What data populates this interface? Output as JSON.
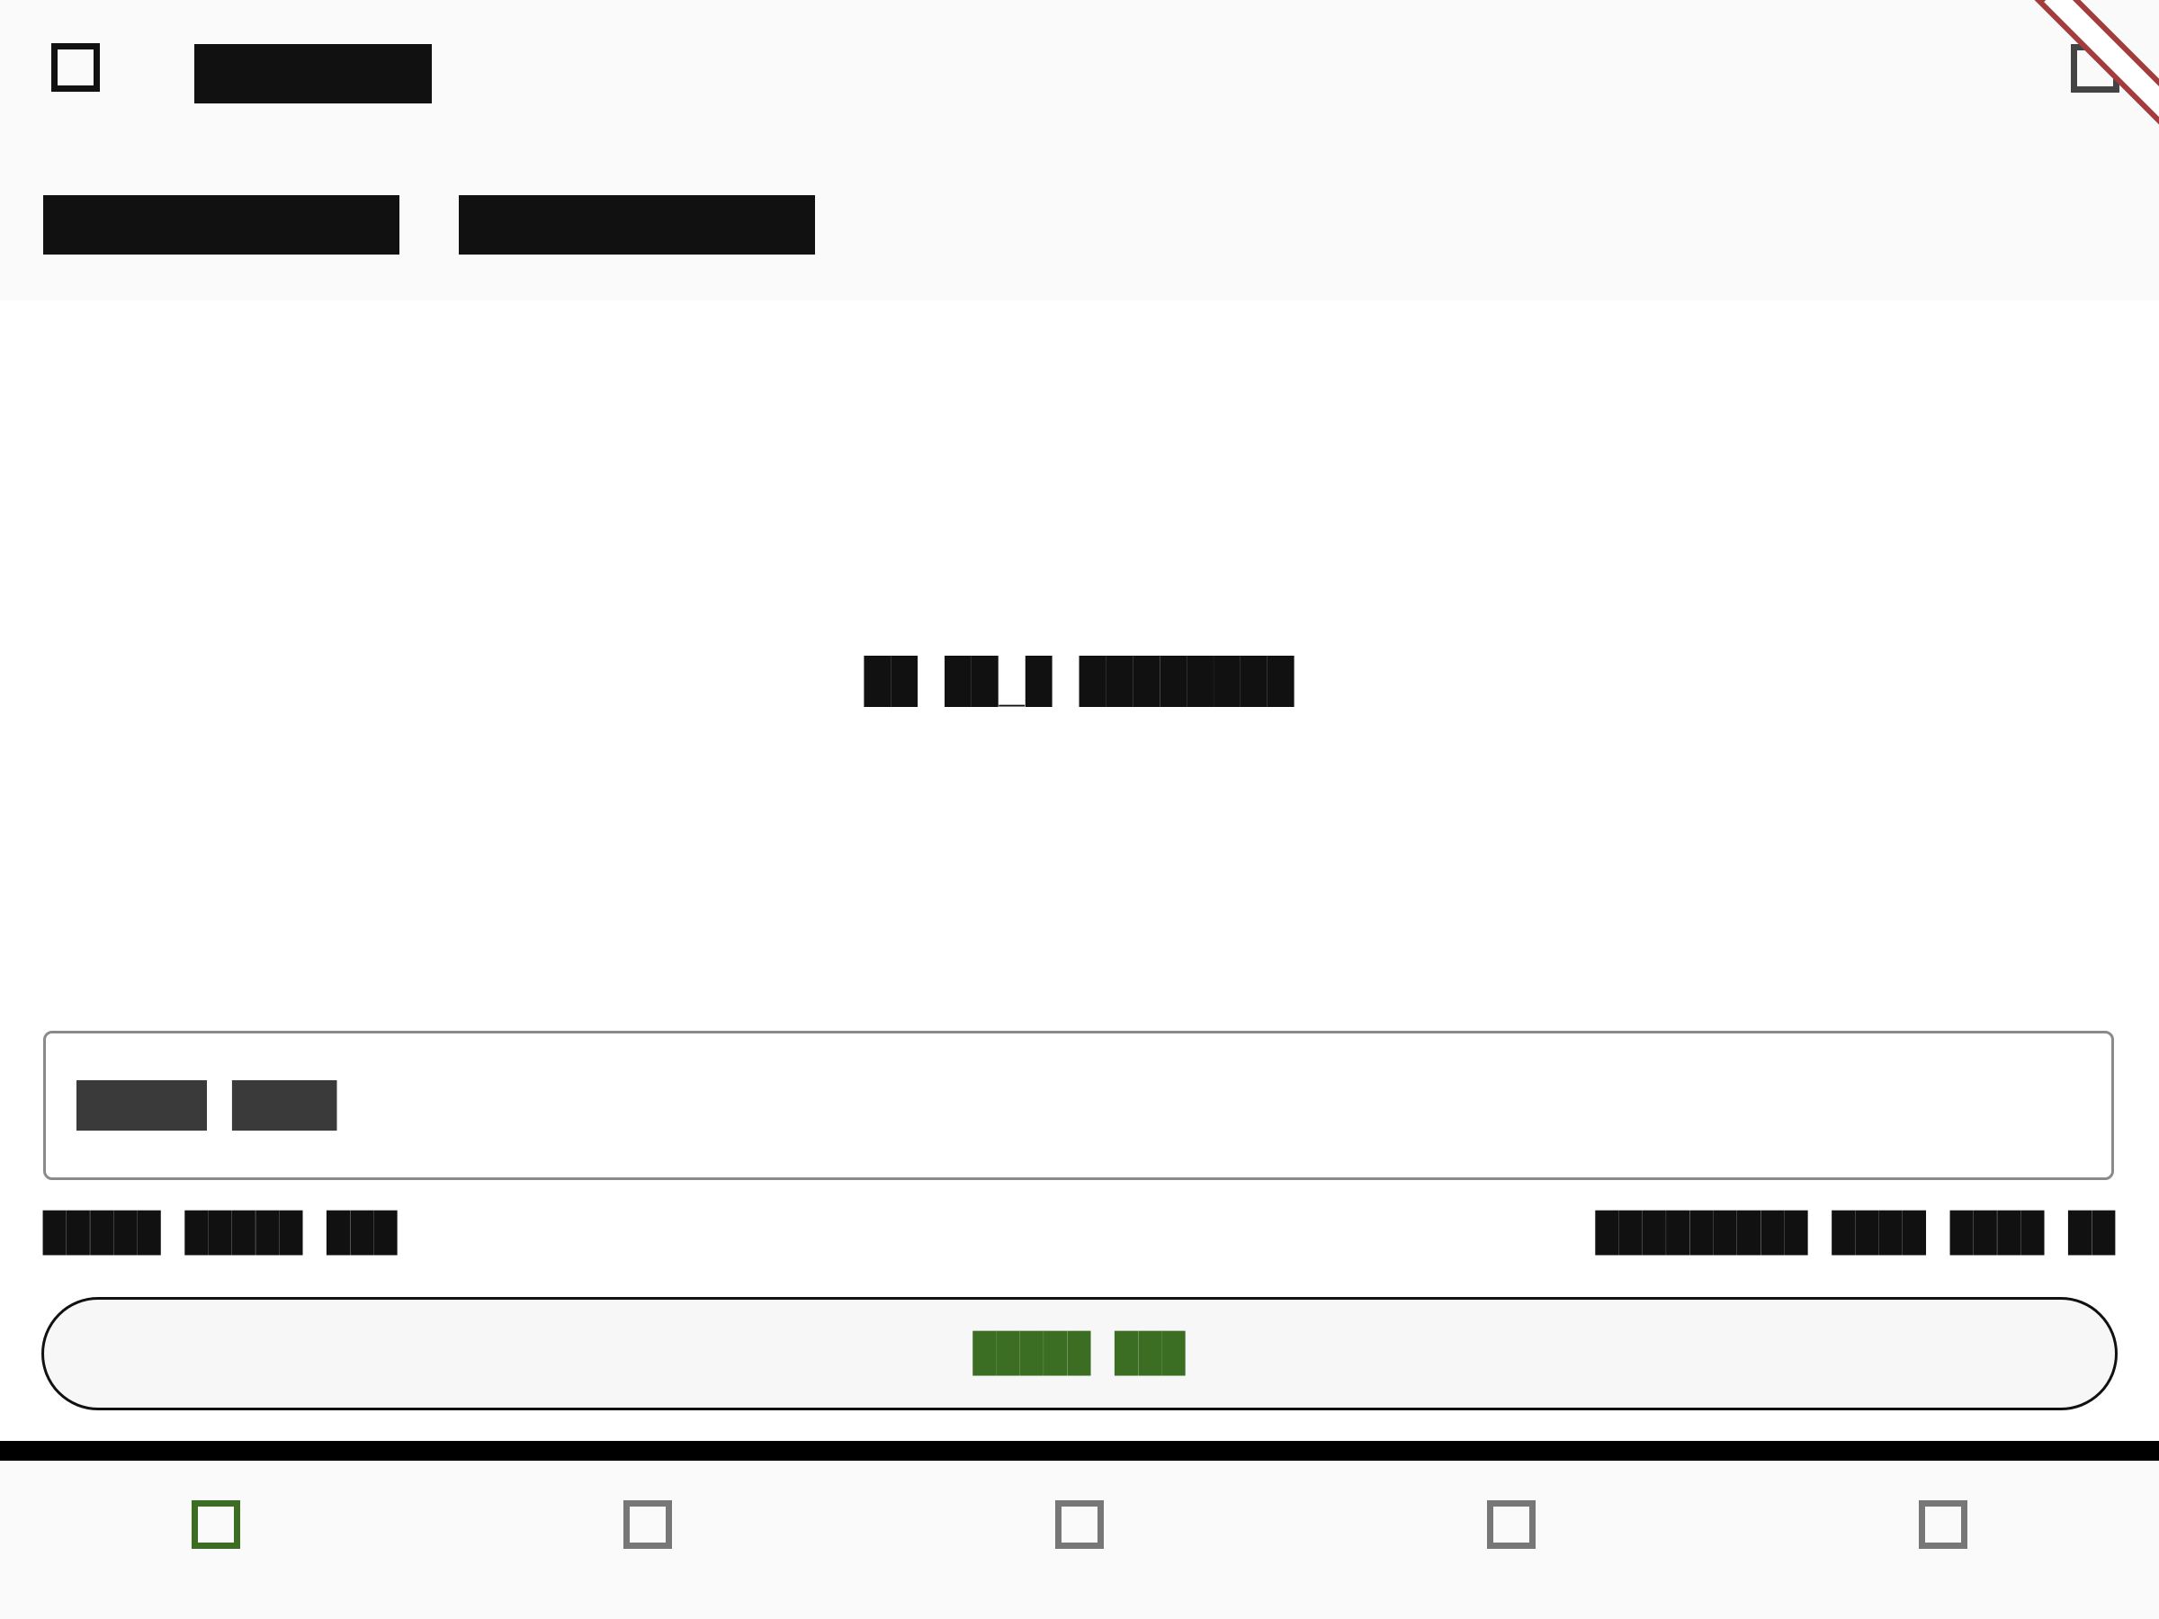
{
  "header": {
    "title": "██████",
    "menu_icon": "menu-icon",
    "settings_icon": "settings-icon",
    "tabs": [
      {
        "label": "█████████"
      },
      {
        "label": "█████████"
      }
    ],
    "debug_banner": "debug-ribbon"
  },
  "main": {
    "empty_message": "██ ██_█ ████████"
  },
  "input": {
    "placeholder": "█████ ████",
    "value": ""
  },
  "hints": {
    "left": "█████ █████ ███",
    "right": "█████████ ████ ████ ██"
  },
  "action_button": {
    "label": "█████ ███"
  },
  "bottom_nav": {
    "items": [
      {
        "icon": "home-icon",
        "active": true
      },
      {
        "icon": "list-icon",
        "active": false
      },
      {
        "icon": "add-icon",
        "active": false
      },
      {
        "icon": "chart-icon",
        "active": false
      },
      {
        "icon": "profile-icon",
        "active": false
      }
    ]
  },
  "colors": {
    "accent": "#3b6e22",
    "text": "#111111",
    "muted_icon": "#777777",
    "header_bg": "#fafafa",
    "debug_ribbon": "#a33c3c"
  }
}
